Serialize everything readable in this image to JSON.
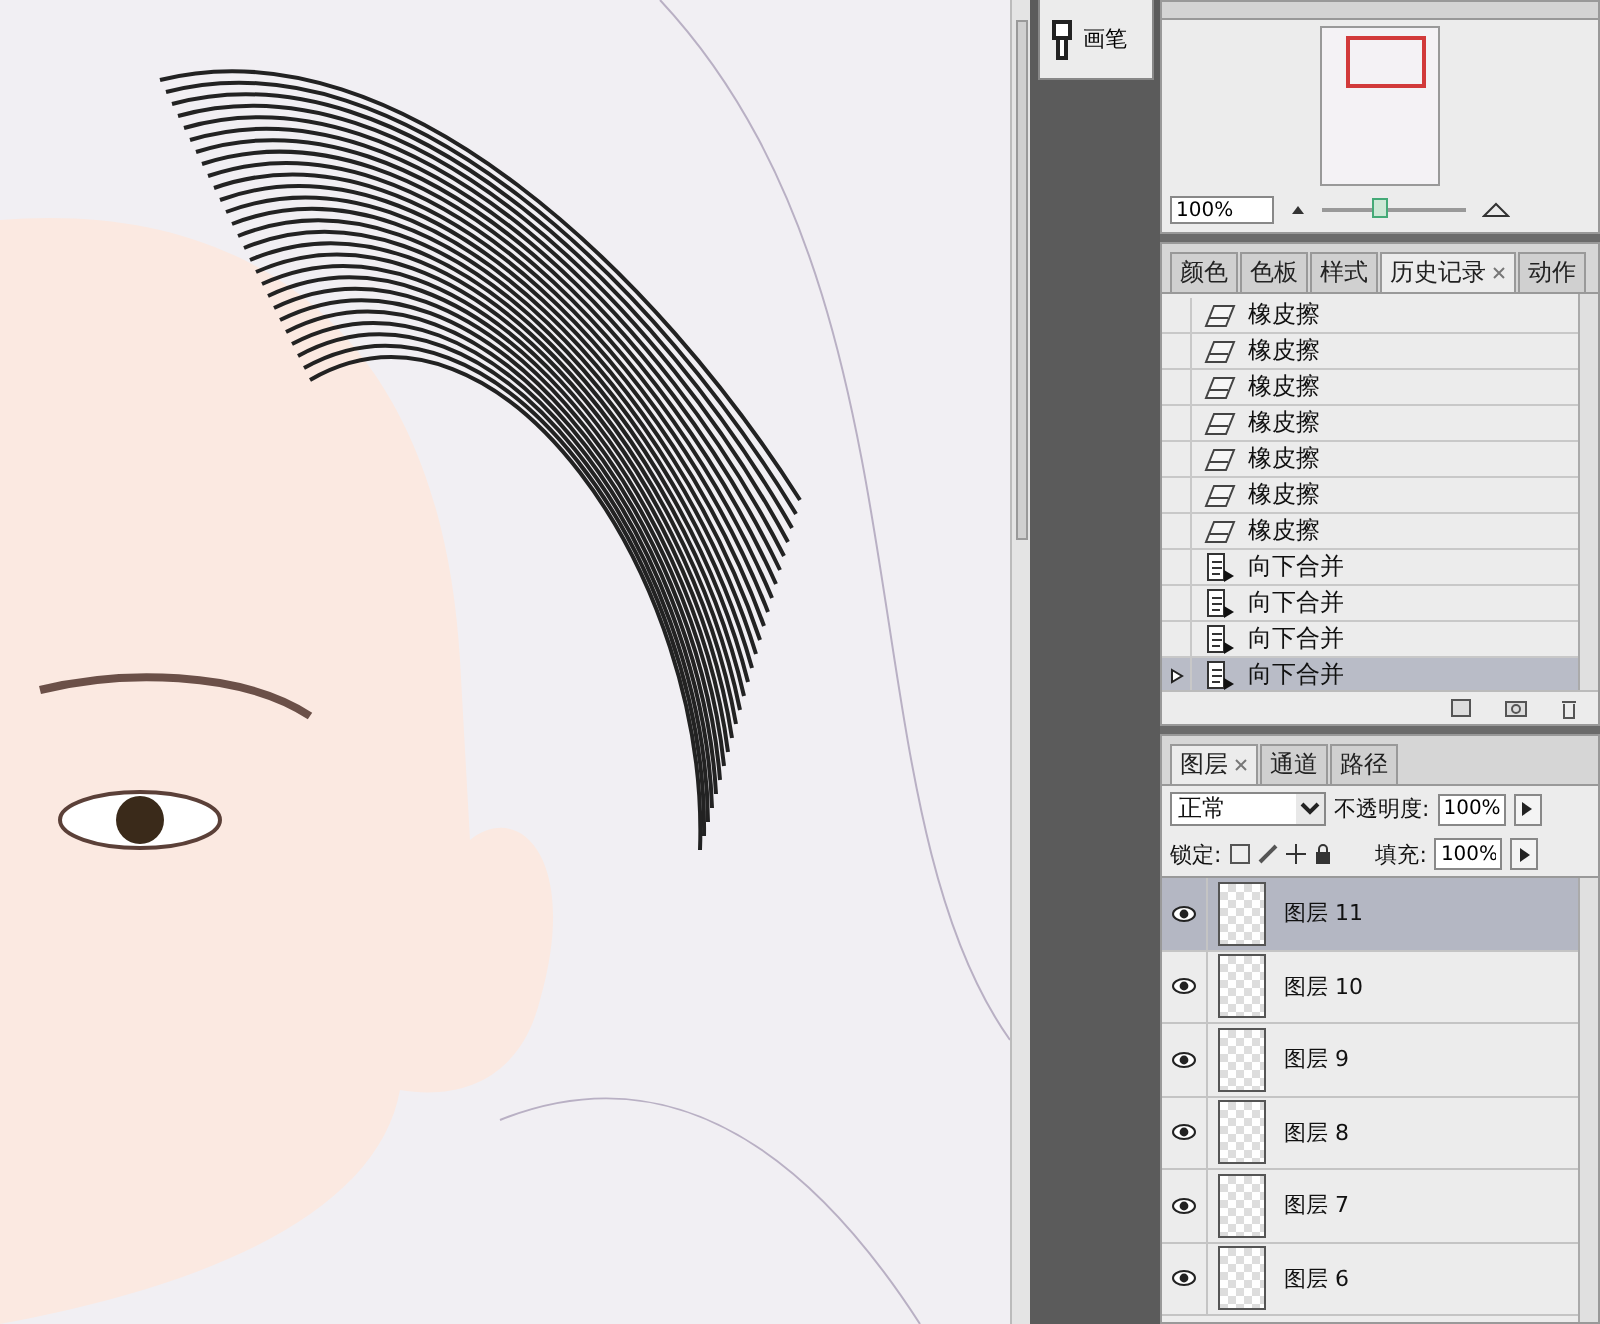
{
  "brush_button": {
    "label": "画笔"
  },
  "navigator": {
    "zoom": "100%",
    "zoom_slider": {
      "level": 0.4
    }
  },
  "history": {
    "tabs": [
      {
        "label": "颜色",
        "selected": false,
        "closable": false
      },
      {
        "label": "色板",
        "selected": false,
        "closable": false
      },
      {
        "label": "样式",
        "selected": false,
        "closable": false
      },
      {
        "label": "历史记录",
        "selected": true,
        "closable": true
      },
      {
        "label": "动作",
        "selected": false,
        "closable": false
      }
    ],
    "items": [
      {
        "kind": "eraser",
        "label": "橡皮擦",
        "selected": false
      },
      {
        "kind": "eraser",
        "label": "橡皮擦",
        "selected": false
      },
      {
        "kind": "eraser",
        "label": "橡皮擦",
        "selected": false
      },
      {
        "kind": "eraser",
        "label": "橡皮擦",
        "selected": false
      },
      {
        "kind": "eraser",
        "label": "橡皮擦",
        "selected": false
      },
      {
        "kind": "eraser",
        "label": "橡皮擦",
        "selected": false
      },
      {
        "kind": "eraser",
        "label": "橡皮擦",
        "selected": false
      },
      {
        "kind": "merge",
        "label": "向下合并",
        "selected": false
      },
      {
        "kind": "merge",
        "label": "向下合并",
        "selected": false
      },
      {
        "kind": "merge",
        "label": "向下合并",
        "selected": false
      },
      {
        "kind": "merge",
        "label": "向下合并",
        "selected": true
      }
    ]
  },
  "layers": {
    "tabs": [
      {
        "label": "图层",
        "selected": true,
        "closable": true
      },
      {
        "label": "通道",
        "selected": false,
        "closable": false
      },
      {
        "label": "路径",
        "selected": false,
        "closable": false
      }
    ],
    "blend_mode": "正常",
    "opacity_label": "不透明度:",
    "opacity": "100%",
    "lock_label": "锁定:",
    "fill_label": "填充:",
    "fill": "100%",
    "items": [
      {
        "name": "图层 11",
        "visible": true,
        "selected": true
      },
      {
        "name": "图层 10",
        "visible": true,
        "selected": false
      },
      {
        "name": "图层 9",
        "visible": true,
        "selected": false
      },
      {
        "name": "图层 8",
        "visible": true,
        "selected": false
      },
      {
        "name": "图层 7",
        "visible": true,
        "selected": false
      },
      {
        "name": "图层 6",
        "visible": true,
        "selected": false
      }
    ]
  }
}
